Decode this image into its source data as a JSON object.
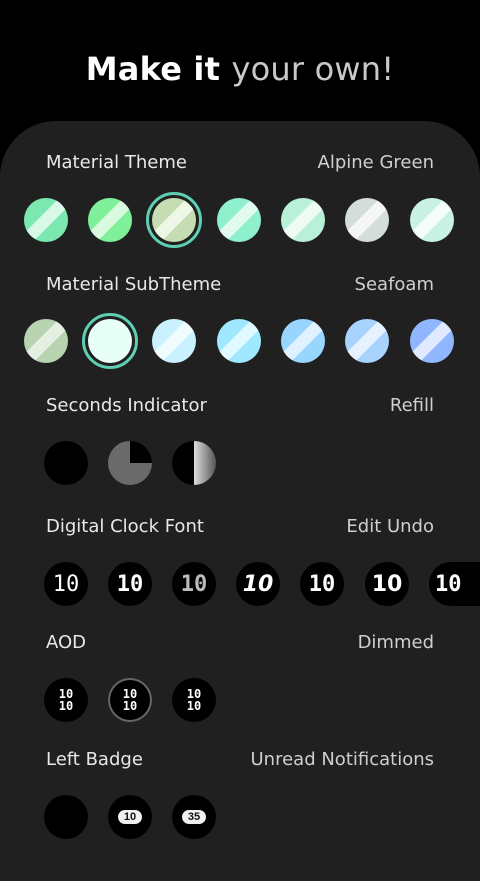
{
  "header": {
    "title_part1": "Make it",
    "title_part2": "your own!"
  },
  "sections": {
    "material_theme": {
      "title": "Material Theme",
      "value": "Alpine Green"
    },
    "material_subtheme": {
      "title": "Material SubTheme",
      "value": "Seafoam"
    },
    "seconds_indicator": {
      "title": "Seconds Indicator",
      "value": "Refill"
    },
    "digital_clock_font": {
      "title": "Digital Clock Font",
      "value": "Edit Undo",
      "samples": [
        "10",
        "10",
        "10",
        "10",
        "10",
        "10",
        "10"
      ]
    },
    "aod": {
      "title": "AOD",
      "value": "Dimmed",
      "samples": [
        "10\n10",
        "10\n10",
        "10\n10"
      ]
    },
    "left_badge": {
      "title": "Left Badge",
      "value": "Unread Notifications",
      "samples": [
        "",
        "10",
        "35"
      ]
    }
  },
  "colors": {
    "selection_ring": "#5fcfb3",
    "panel": "#202020",
    "theme_swatches": [
      "#7be8b0",
      "#7ef09a",
      "#c6dcb3",
      "#8ef0cd",
      "#b9f0d8",
      "#d5ddd8",
      "#c9f1e4"
    ],
    "subtheme_swatches": [
      "#b7d3b0",
      "#e8fff8",
      "#c9f1ff",
      "#9fe8ff",
      "#99d6ff",
      "#a8d3ff",
      "#8fb6ff"
    ]
  }
}
